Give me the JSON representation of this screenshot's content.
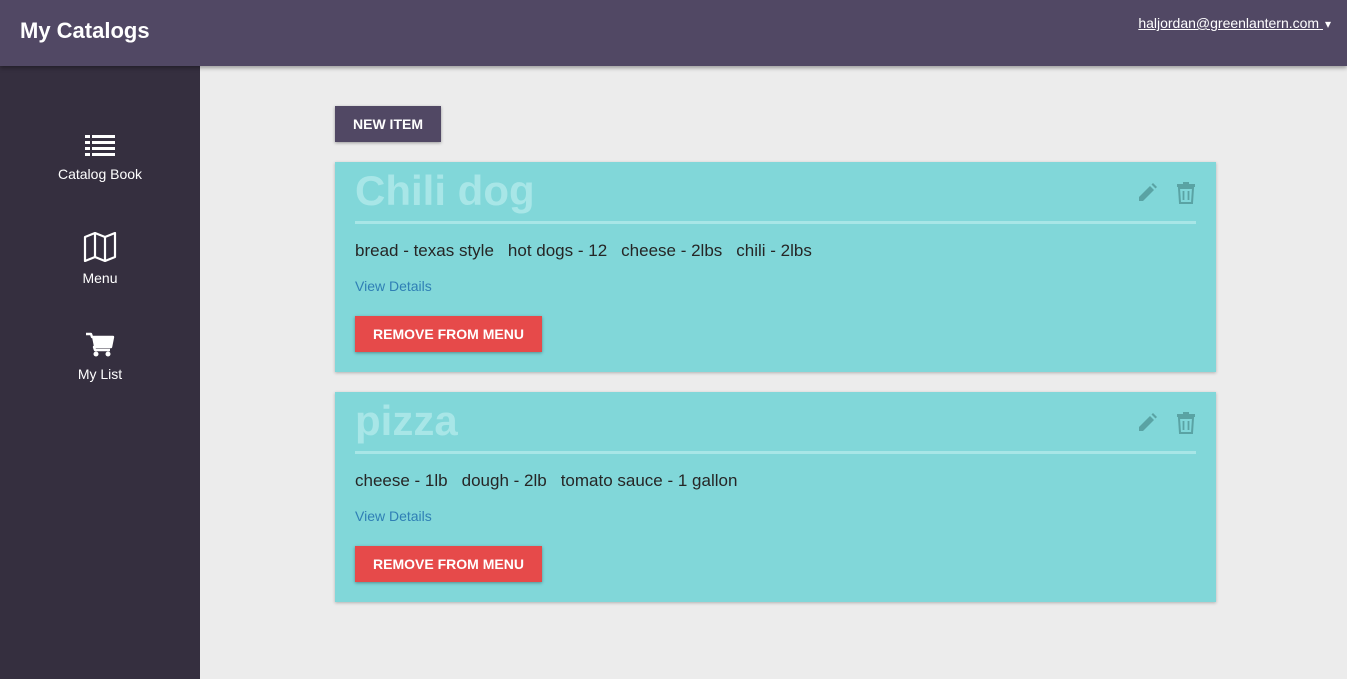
{
  "header": {
    "title": "My Catalogs",
    "user_email": "haljordan@greenlantern.com",
    "user_caret": "▾"
  },
  "sidebar": {
    "items": [
      {
        "label": "Catalog Book",
        "icon": "list-icon"
      },
      {
        "label": "Menu",
        "icon": "map-icon"
      },
      {
        "label": "My List",
        "icon": "cart-icon"
      }
    ]
  },
  "main": {
    "new_item_label": "NEW ITEM",
    "cards": [
      {
        "title": "Chili dog",
        "ingredients": [
          "bread - texas style",
          "hot dogs - 12",
          "cheese - 2lbs",
          "chili - 2lbs"
        ],
        "view_details": "View Details",
        "remove_label": "REMOVE FROM MENU"
      },
      {
        "title": "pizza",
        "ingredients": [
          "cheese - 1lb",
          "dough - 2lb",
          "tomato sauce - 1 gallon"
        ],
        "view_details": "View Details",
        "remove_label": "REMOVE FROM MENU"
      }
    ]
  },
  "colors": {
    "topbar": "#514864",
    "sidebar": "#352f3f",
    "card": "#81d7d9",
    "remove_button": "#e64a4a",
    "link": "#2f7fb5"
  }
}
